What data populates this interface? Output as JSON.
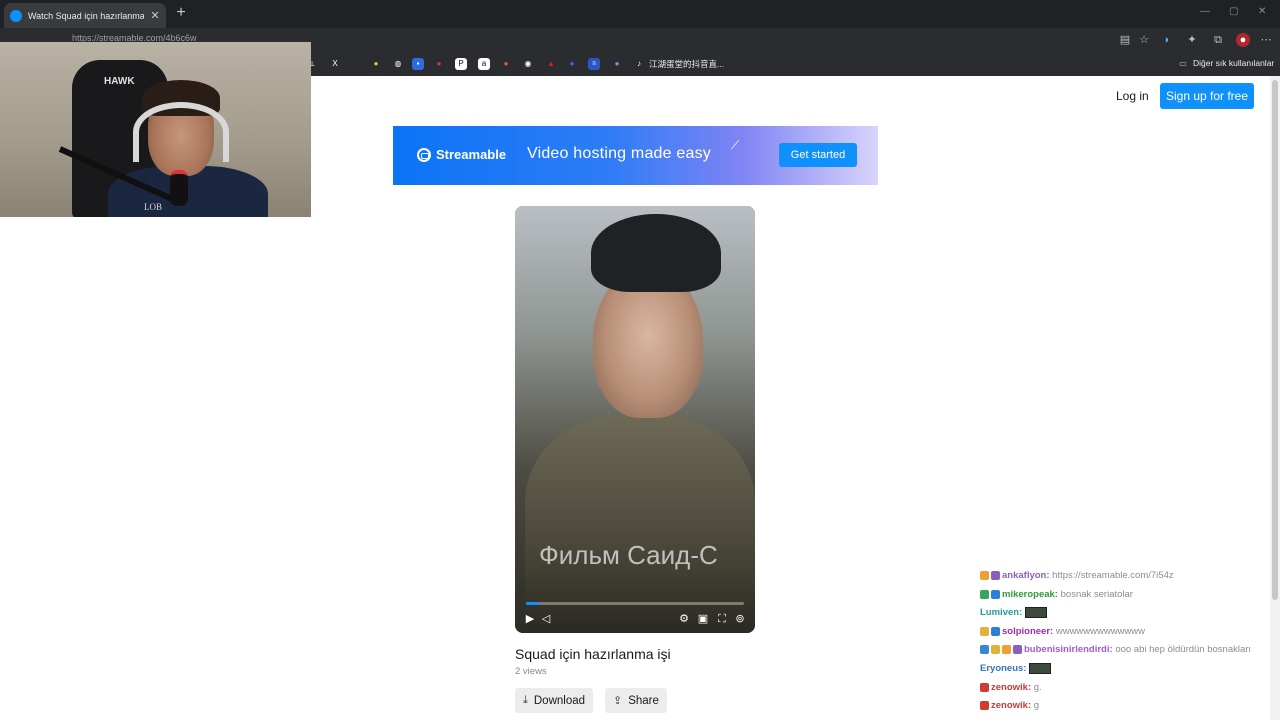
{
  "browser": {
    "tab_title": "Watch Squad için hazırlanma işi | S",
    "tab_close": "✕",
    "new_tab": "+",
    "url": "https://streamable.com/4b6c6w",
    "window_controls": [
      "—",
      "▢",
      "✕"
    ],
    "bookmarks_folder_label": "Diğer sık kullanılanlar",
    "bookmark_text_item": "江湖蛋堂的抖音直...",
    "bookmark_icon_colors": [
      "#ffffff",
      "#ffffff",
      "#e2c13a",
      "#cfcfcf",
      "#2d6bde",
      "#d23b2f",
      "#ffffff",
      "#e05a27",
      "#ffffff",
      "#d12026",
      "#2f6fe4",
      "#2a56c6",
      "#8a86e8"
    ]
  },
  "header": {
    "login": "Log in",
    "signup": "Sign up for free"
  },
  "banner": {
    "brand": "Streamable",
    "slogan": "Video hosting made easy",
    "cta": "Get started"
  },
  "video": {
    "subtitle_overlay": "Фильм Саид-С",
    "progress": 0.06,
    "title": "Squad için hazırlanma işi",
    "views": "2 views"
  },
  "actions": {
    "download": "Download",
    "share": "Share"
  },
  "webcam": {
    "chair_logo": "HAWK",
    "shirt_text": "LOB"
  },
  "chat": [
    {
      "user": "ankaflyon:",
      "user_color": "#8b5fbf",
      "message": "https://streamable.com/7i54z",
      "badges": [
        "#f0a030",
        "#8b5fbf"
      ]
    },
    {
      "user": "mikeropeak:",
      "user_color": "#2e9b3a",
      "message": "bosnak seriatolar",
      "badges": [
        "#3aa55a",
        "#2b7fd6"
      ]
    },
    {
      "user": "Lumiven:",
      "user_color": "#1e9e9e",
      "message": "",
      "emote": true,
      "badges": []
    },
    {
      "user": "solpioneer:",
      "user_color": "#9a2fb0",
      "message": "wwwwwwwwwwwww",
      "badges": [
        "#e2b13a",
        "#2b7fd6"
      ]
    },
    {
      "user": "bubenisinirlendirdi:",
      "user_color": "#a45ad6",
      "message": "ooo abi hep öldürdün bosnakları",
      "badges": [
        "#3a86d6",
        "#e2b13a",
        "#f0a030",
        "#8b5fbf"
      ]
    },
    {
      "user": "Eryoneus:",
      "user_color": "#3a6fc2",
      "message": "",
      "emote": true,
      "badges": []
    },
    {
      "user": "zenowik:",
      "user_color": "#c63a3a",
      "message": "g.",
      "badges": [
        "#d23b2f"
      ]
    },
    {
      "user": "zenowik:",
      "user_color": "#c63a3a",
      "message": "g",
      "badges": [
        "#d23b2f"
      ]
    }
  ]
}
